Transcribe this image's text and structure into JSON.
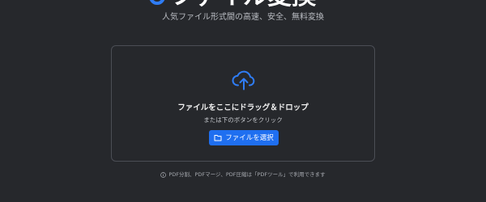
{
  "header": {
    "title": "ファイル変換",
    "subtitle": "人気ファイル形式間の高速、安全、無料変換"
  },
  "upload": {
    "icon": "upload-cloud-icon",
    "title": "ファイルをここにドラッグ＆ドロップ",
    "hint": "または下のボタンをクリック",
    "button_label": "ファイルを選択",
    "button_icon": "folder-icon"
  },
  "footer": {
    "icon": "info-icon",
    "note": "PDF分割、PDFマージ、PDF圧縮は「PDFツール」で利用できます"
  },
  "colors": {
    "background": "#26282c",
    "accent": "#1f6ff0",
    "border": "#4b4e55"
  }
}
